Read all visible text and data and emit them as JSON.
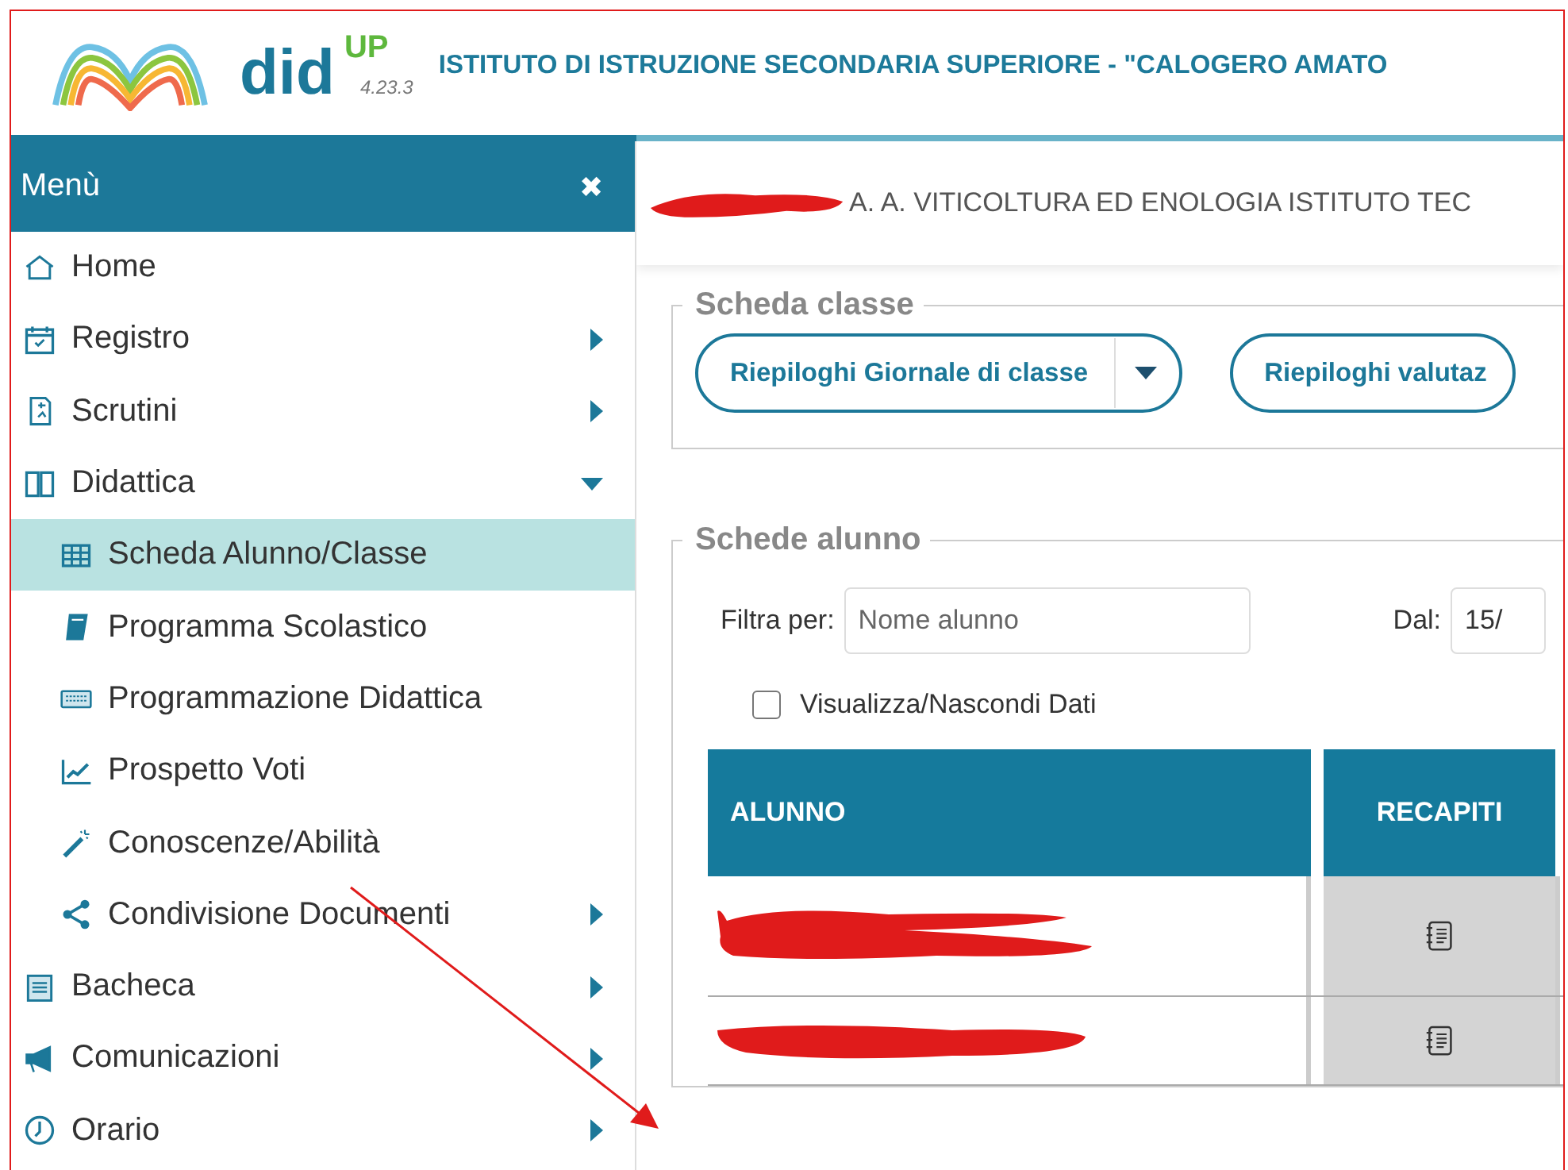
{
  "header": {
    "brand": "did",
    "brand_sup": "UP",
    "version": "4.23.3",
    "institute": "ISTITUTO DI ISTRUZIONE SECONDARIA SUPERIORE - \"CALOGERO AMATO"
  },
  "sidebar": {
    "title": "Menù",
    "close": "✖",
    "items": [
      {
        "label": "Home",
        "selected": false
      },
      {
        "label": "Registro",
        "expanded": false,
        "selected": false
      },
      {
        "label": "Scrutini",
        "expanded": false,
        "selected": false
      },
      {
        "label": "Didattica",
        "expanded": true,
        "selected": false,
        "children": [
          {
            "label": "Scheda Alunno/Classe",
            "selected": true
          },
          {
            "label": "Programma Scolastico",
            "selected": false
          },
          {
            "label": "Programmazione Didattica",
            "selected": false
          },
          {
            "label": "Prospetto Voti",
            "selected": false
          },
          {
            "label": "Conoscenze/Abilità",
            "selected": false
          },
          {
            "label": "Condivisione Documenti",
            "expanded": false,
            "selected": false
          }
        ]
      },
      {
        "label": "Bacheca",
        "expanded": false,
        "selected": false
      },
      {
        "label": "Comunicazioni",
        "expanded": false,
        "selected": false
      },
      {
        "label": "Orario",
        "expanded": false,
        "selected": false
      }
    ]
  },
  "class_bar": {
    "redacted": true,
    "text": "A. A. VITICOLTURA ED ENOLOGIA ISTITUTO TEC"
  },
  "scheda_classe": {
    "legend": "Scheda classe",
    "buttons": [
      {
        "label": "Riepiloghi Giornale di classe",
        "dropdown": true
      },
      {
        "label": "Riepiloghi valutaz",
        "dropdown": false
      }
    ]
  },
  "schede_alunno": {
    "legend": "Schede alunno",
    "filter_label": "Filtra per:",
    "filter": {
      "placeholder": "Nome alunno"
    },
    "from_label": "Dal:",
    "from": {
      "value": "15/"
    },
    "toggle": {
      "label": "Visualizza/Nascondi Dati",
      "checked": false
    },
    "table": {
      "columns": [
        "ALUNNO",
        "RECAPITI"
      ],
      "rows": [
        {
          "kind": "redacted-two-line"
        },
        {
          "kind": "redacted-one-line"
        }
      ]
    }
  },
  "annotation": {
    "kind": "arrow"
  }
}
